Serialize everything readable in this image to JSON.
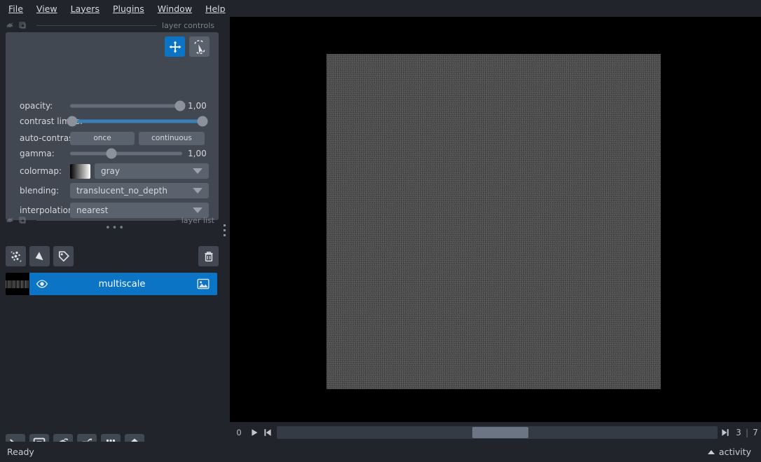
{
  "window": {
    "app": "napari",
    "background": "#21252b",
    "accent": "#0b74c4"
  },
  "menubar": {
    "items": [
      {
        "label": "File",
        "mnemonic": "F"
      },
      {
        "label": "View",
        "mnemonic": "V"
      },
      {
        "label": "Layers",
        "mnemonic": "L"
      },
      {
        "label": "Plugins",
        "mnemonic": "P"
      },
      {
        "label": "Window",
        "mnemonic": "W"
      },
      {
        "label": "Help",
        "mnemonic": "H"
      }
    ]
  },
  "docks": {
    "layer_controls": {
      "title": "layer controls",
      "float_icon": "float-icon",
      "pin_icon": "pin-icon"
    },
    "layer_list": {
      "title": "layer list",
      "float_icon": "float-icon",
      "pin_icon": "pin-icon"
    }
  },
  "layer_controls": {
    "mode_buttons": [
      {
        "name": "pan-zoom-tool",
        "icon": "move-arrows-icon",
        "active": true
      },
      {
        "name": "transform-tool",
        "icon": "transform-icon",
        "active": false
      }
    ],
    "rows": {
      "opacity": {
        "label": "opacity:",
        "value": "1,00",
        "fraction": 1.0
      },
      "contrast_limits": {
        "label": "contrast limits:",
        "low_fraction": 0.0,
        "high_fraction": 1.0
      },
      "auto_contrast": {
        "label": "auto-contrast:",
        "once_label": "once",
        "continuous_label": "continuous"
      },
      "gamma": {
        "label": "gamma:",
        "value": "1,00",
        "fraction": 0.37
      },
      "colormap": {
        "label": "colormap:",
        "value": "gray",
        "swatch_from": "#000000",
        "swatch_to": "#ffffff"
      },
      "blending": {
        "label": "blending:",
        "value": "translucent_no_depth"
      },
      "interpolation": {
        "label": "interpolation:",
        "value": "nearest"
      }
    },
    "grip": "•••"
  },
  "layer_list": {
    "buttons": [
      {
        "name": "new-points-button",
        "icon": "points-icon"
      },
      {
        "name": "new-shapes-button",
        "icon": "shapes-icon"
      },
      {
        "name": "new-labels-button",
        "icon": "labels-tag-icon"
      }
    ],
    "delete_button": {
      "name": "delete-layer-button",
      "icon": "trash-icon"
    },
    "layers": [
      {
        "name": "multiscale",
        "selected": true,
        "visible": true,
        "visibility_icon": "eye-icon",
        "type_icon": "image-icon",
        "thumbnail": "noise-thumbnail"
      }
    ]
  },
  "viewer_buttons": [
    {
      "name": "console-button",
      "icon": "console-icon"
    },
    {
      "name": "roll-dimensions-button",
      "icon": "roll-dims-icon"
    },
    {
      "name": "toggle-ndisplay-button",
      "icon": "cube-3d-icon"
    },
    {
      "name": "transpose-dimensions-button",
      "icon": "transpose-icon"
    },
    {
      "name": "grid-view-button",
      "icon": "grid-icon"
    },
    {
      "name": "reset-view-button",
      "icon": "home-icon"
    }
  ],
  "canvas": {
    "background": "#000000",
    "image_label": "multiscale-noise-image"
  },
  "dims": {
    "axis_label": "0",
    "play_button": "play-icon",
    "step_left_button": "step-left-icon",
    "step_right_button": "step-right-icon",
    "current": "3",
    "separator": "|",
    "max": "7",
    "handle_fraction": 0.444
  },
  "statusbar": {
    "status": "Ready",
    "activity_label": "activity",
    "activity_chevron": "chevron-up-icon"
  }
}
